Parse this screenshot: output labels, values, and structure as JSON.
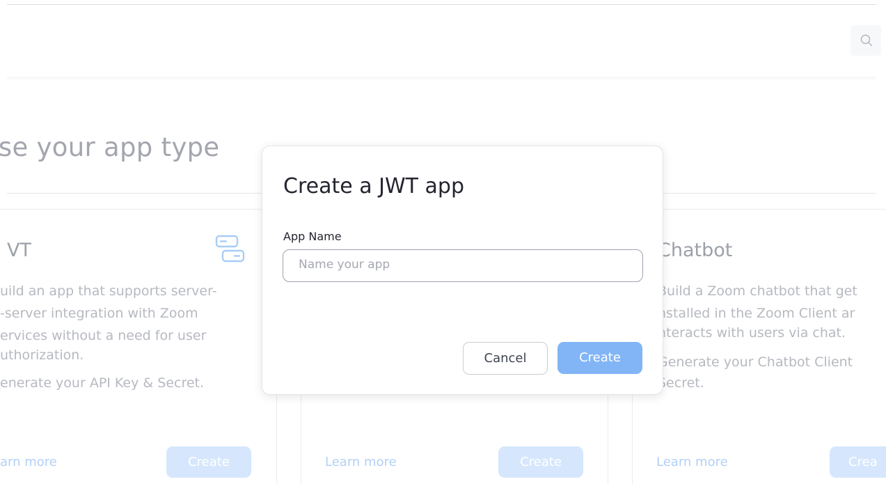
{
  "page": {
    "title": "oose your app type",
    "search_icon": "search-icon"
  },
  "cards": [
    {
      "title": "VT",
      "icon": "server-stack-icon",
      "description": [
        "uild an app that supports server-",
        "-server integration with Zoom",
        "ervices without a need for user",
        "uthorization.",
        "enerate your API Key & Secret."
      ],
      "learn_more": "arn more",
      "create_label": "Create"
    },
    {
      "title": "",
      "description": [],
      "learn_more": "Learn more",
      "create_label": "Create"
    },
    {
      "title": "Chatbot",
      "description": [
        "Build a Zoom chatbot that get",
        "nstalled in the Zoom Client ar",
        "nteracts with users via chat.",
        "Generate your Chatbot Client",
        "Secret."
      ],
      "learn_more": "Learn more",
      "create_label": "Crea"
    }
  ],
  "modal": {
    "title": "Create a JWT app",
    "field_label": "App Name",
    "input_value": "",
    "input_placeholder": "Name your app",
    "cancel_label": "Cancel",
    "create_label": "Create",
    "accent": "#82b5f6"
  }
}
